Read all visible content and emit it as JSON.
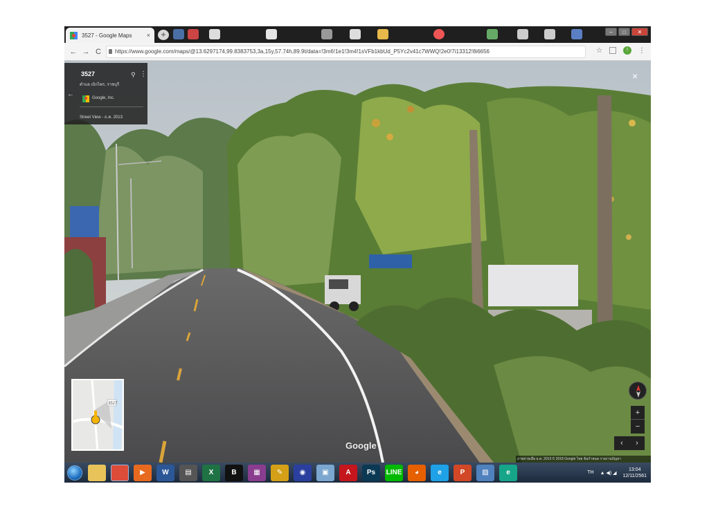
{
  "browser": {
    "tab_title": "3527 - Google Maps",
    "tab_close": "×",
    "new_tab": "+",
    "window_controls": {
      "minimize": "–",
      "maximize": "□",
      "close": "✕"
    },
    "nav": {
      "back": "←",
      "forward": "→",
      "reload": "C"
    },
    "url": "https://www.google.com/maps/@13.6297174,99.8383753,3a,15y,57.74h,89.9t/data=!3m6!1e1!3m4!1sVFb1kbUd_P5Yc2v41c7WWQ!2e0!7i13312!8i6656",
    "toolbar_icons": [
      "star-icon",
      "extension-icon",
      "profile-icon",
      "menu-icon"
    ],
    "toolbar_labels": {
      "star": "☆",
      "menu": "⋮",
      "profile": "!"
    }
  },
  "street_view": {
    "info_card": {
      "back": "←",
      "road_name": "3527",
      "location": "ตำบล เบิกไพร, ราชบุรี",
      "credit": "Google, Inc.",
      "capture_date": "Street View - ธ.ค. 2013"
    },
    "close_label": "×",
    "watermark": "Google",
    "minimap_label": "3527",
    "zoom_in": "+",
    "zoom_out": "−",
    "prev": "‹",
    "next": "›",
    "attribution": "ภาพถ่ายเมื่อ ธ.ค. 2013   © 2018 Google   ไทย   ข้อกำหนด   รายงานปัญหา"
  },
  "taskbar": {
    "apps": [
      {
        "name": "explorer",
        "label": "",
        "color": "#e8c35a"
      },
      {
        "name": "chrome",
        "label": "",
        "color": "#dd4b39",
        "active": true
      },
      {
        "name": "media-player",
        "label": "▶",
        "color": "#e86a1f"
      },
      {
        "name": "word",
        "label": "W",
        "color": "#2b5797"
      },
      {
        "name": "video-editor",
        "label": "▤",
        "color": "#555555"
      },
      {
        "name": "excel-like",
        "label": "X",
        "color": "#1f7244"
      },
      {
        "name": "b-app",
        "label": "B",
        "color": "#111111"
      },
      {
        "name": "winrar",
        "label": "▦",
        "color": "#8a3d8f"
      },
      {
        "name": "tool",
        "label": "✎",
        "color": "#d4a017"
      },
      {
        "name": "disc",
        "label": "◉",
        "color": "#2b3f9e"
      },
      {
        "name": "photos",
        "label": "▣",
        "color": "#7aa6cf"
      },
      {
        "name": "acrobat",
        "label": "A",
        "color": "#c4161c"
      },
      {
        "name": "photoshop",
        "label": "Ps",
        "color": "#0b3954"
      },
      {
        "name": "line",
        "label": "LINE",
        "color": "#00b900"
      },
      {
        "name": "firefox",
        "label": "◕",
        "color": "#e66000"
      },
      {
        "name": "ie",
        "label": "e",
        "color": "#1ea1e6"
      },
      {
        "name": "powerpoint",
        "label": "P",
        "color": "#d24726"
      },
      {
        "name": "gallery",
        "label": "▨",
        "color": "#4f81bd"
      },
      {
        "name": "edge-like",
        "label": "e",
        "color": "#17a589"
      }
    ],
    "lang": "TH",
    "tray_icons": "▲ ◀) ◢",
    "time": "13:04",
    "date": "12/11/2561"
  }
}
